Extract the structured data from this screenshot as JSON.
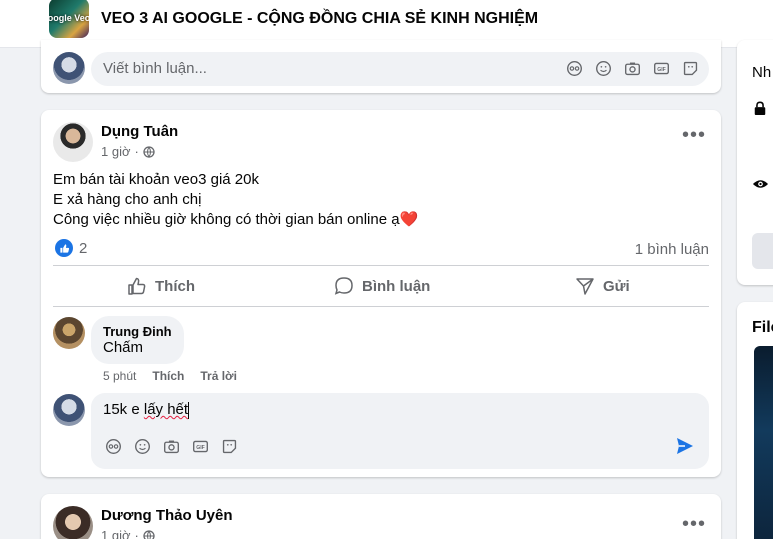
{
  "header": {
    "group_thumb_text": "oogle Veo",
    "title": "VEO 3 AI GOOGLE - CỘNG ĐỒNG CHIA SẺ KINH NGHIỆM"
  },
  "top_comment_box": {
    "placeholder": "Viết bình luận..."
  },
  "post": {
    "author": "Dụng Tuân",
    "time": "1 giờ",
    "lines": [
      "Em bán tài khoản veo3 giá 20k",
      "E xả hàng cho anh chị",
      "Công việc nhiều giờ không có thời gian bán online ạ"
    ],
    "line_emoji": "❤️",
    "like_count": "2",
    "comment_count": "1 bình luận",
    "actions": {
      "like": "Thích",
      "comment": "Bình luận",
      "send": "Gửi"
    },
    "comment": {
      "author": "Trung Đinh",
      "text": "Chấm",
      "time": "5 phút",
      "like": "Thích",
      "reply": "Trả lời"
    },
    "draft": {
      "prefix": "15k e ",
      "misspelled": "lấy hết"
    }
  },
  "next_post": {
    "author": "Dương Thảo Uyên",
    "time": "1 giờ"
  },
  "right_panel": {
    "top_text": "Nh",
    "files_label": "File"
  },
  "colors": {
    "accent": "#1b74e4",
    "heart": "#e41e3f",
    "muted": "#65676b"
  }
}
